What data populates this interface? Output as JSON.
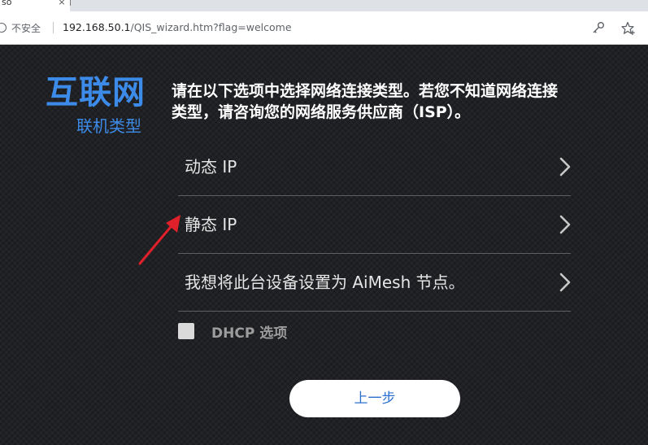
{
  "browser": {
    "tab_title": "so",
    "tab_close": "×",
    "security_label": "不安全",
    "url_host": "192.168.50.1",
    "url_path": "/QIS_wizard.htm?flag=welcome",
    "icons": [
      "warning-icon",
      "key-icon",
      "favorite-star-icon"
    ]
  },
  "page": {
    "brand_title": "互联网",
    "brand_subtitle": "联机类型",
    "instruction": "请在以下选项中选择网络连接类型。若您不知道网络连接类型，请咨询您的网络服务供应商（ISP）。",
    "options": [
      {
        "label": "动态 IP"
      },
      {
        "label": "静态 IP"
      },
      {
        "label": "我想将此台设备设置为 AiMesh 节点。"
      }
    ],
    "dhcp_label": "DHCP 选项",
    "dhcp_checked": false,
    "back_label": "上一步"
  },
  "colors": {
    "background": "#202124",
    "brand_blue": "#3d8be8",
    "button_text": "#2b6fcf",
    "annotation_arrow": "#e0202a"
  }
}
